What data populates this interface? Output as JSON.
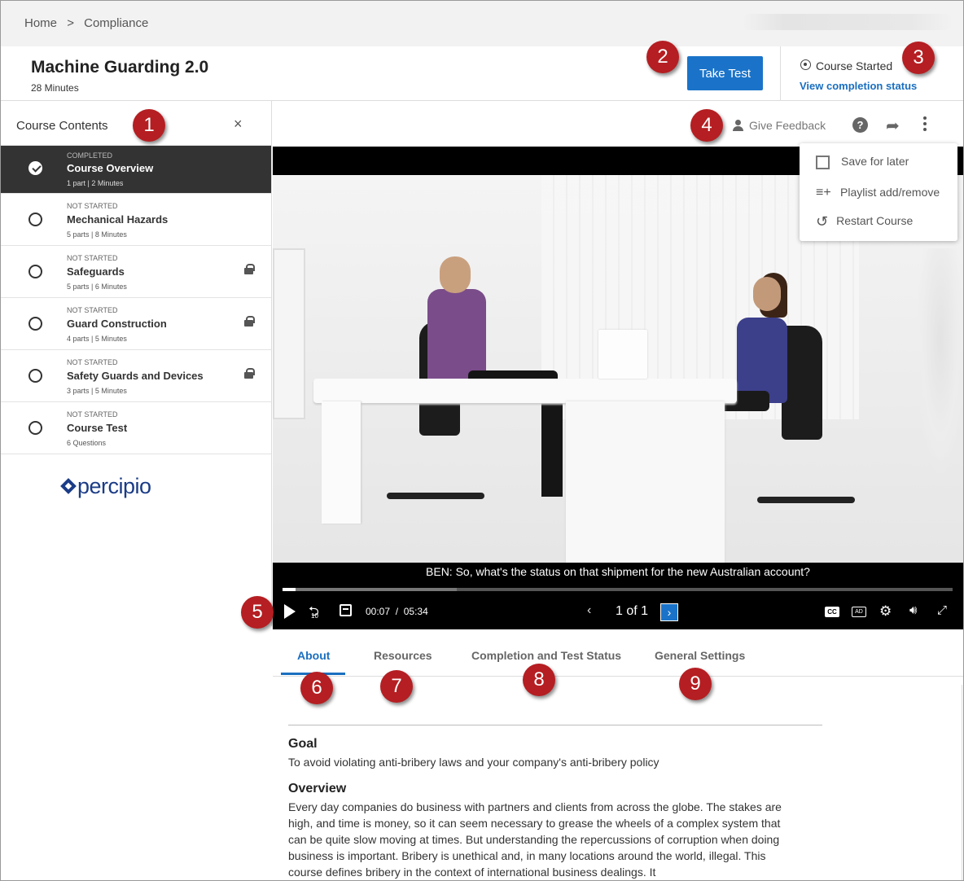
{
  "breadcrumb": [
    "Home",
    ">",
    "Compliance"
  ],
  "course": {
    "title": "Machine Guarding 2.0",
    "duration": "28 Minutes",
    "take_test_label": "Take Test",
    "status_label": "Course Started",
    "completion_link": "View completion status"
  },
  "sidebar": {
    "title": "Course Contents",
    "close_glyph": "×",
    "items": [
      {
        "status": "COMPLETED",
        "name": "Course Overview",
        "meta": "1 part | 2 Minutes"
      },
      {
        "status": "NOT STARTED",
        "name": "Mechanical Hazards",
        "meta": "5 parts | 8 Minutes"
      },
      {
        "status": "NOT STARTED",
        "name": "Safeguards",
        "meta": "5 parts | 6 Minutes"
      },
      {
        "status": "NOT STARTED",
        "name": "Guard Construction",
        "meta": "4 parts | 5 Minutes"
      },
      {
        "status": "NOT STARTED",
        "name": "Safety Guards and Devices",
        "meta": "3 parts | 5 Minutes"
      },
      {
        "status": "NOT STARTED",
        "name": "Course Test",
        "meta": "6 Questions"
      }
    ],
    "logo_text": "percipio"
  },
  "toolbar": {
    "feedback_label": "Give Feedback",
    "help_glyph": "?",
    "share_glyph": "➦"
  },
  "menu": {
    "save_label": "Save for later",
    "playlist_label": "Playlist add/remove",
    "restart_label": "Restart Course"
  },
  "video": {
    "caption": "BEN: So, what's the status on that shipment for the new Australian account?",
    "current_time": "00:07",
    "separator": "/",
    "total_time": "05:34",
    "page_indicator": "1 of 1",
    "progress": 0.02,
    "buffered": 0.26,
    "replay_seconds": "10",
    "cc_label": "CC",
    "ad_label": "AD"
  },
  "tabs": [
    "About",
    "Resources",
    "Completion and Test Status",
    "General Settings"
  ],
  "about": {
    "goal_heading": "Goal",
    "goal_text": "To avoid violating anti-bribery laws and your company's anti-bribery policy",
    "overview_heading": "Overview",
    "overview_text": "Every day companies do business with partners and clients from across the globe. The stakes are high, and time is money, so it can seem necessary to grease the wheels of a complex system that can be quite slow moving at times. But understanding the repercussions of corruption when doing business is important. Bribery is unethical and, in many locations around the world, illegal. This course defines bribery in the context of international business dealings. It"
  },
  "badges": [
    "1",
    "2",
    "3",
    "4",
    "5",
    "6",
    "7",
    "8",
    "9"
  ],
  "colors": {
    "accent": "#1a73c9",
    "badge": "#b51e22",
    "active_item": "#333333"
  }
}
